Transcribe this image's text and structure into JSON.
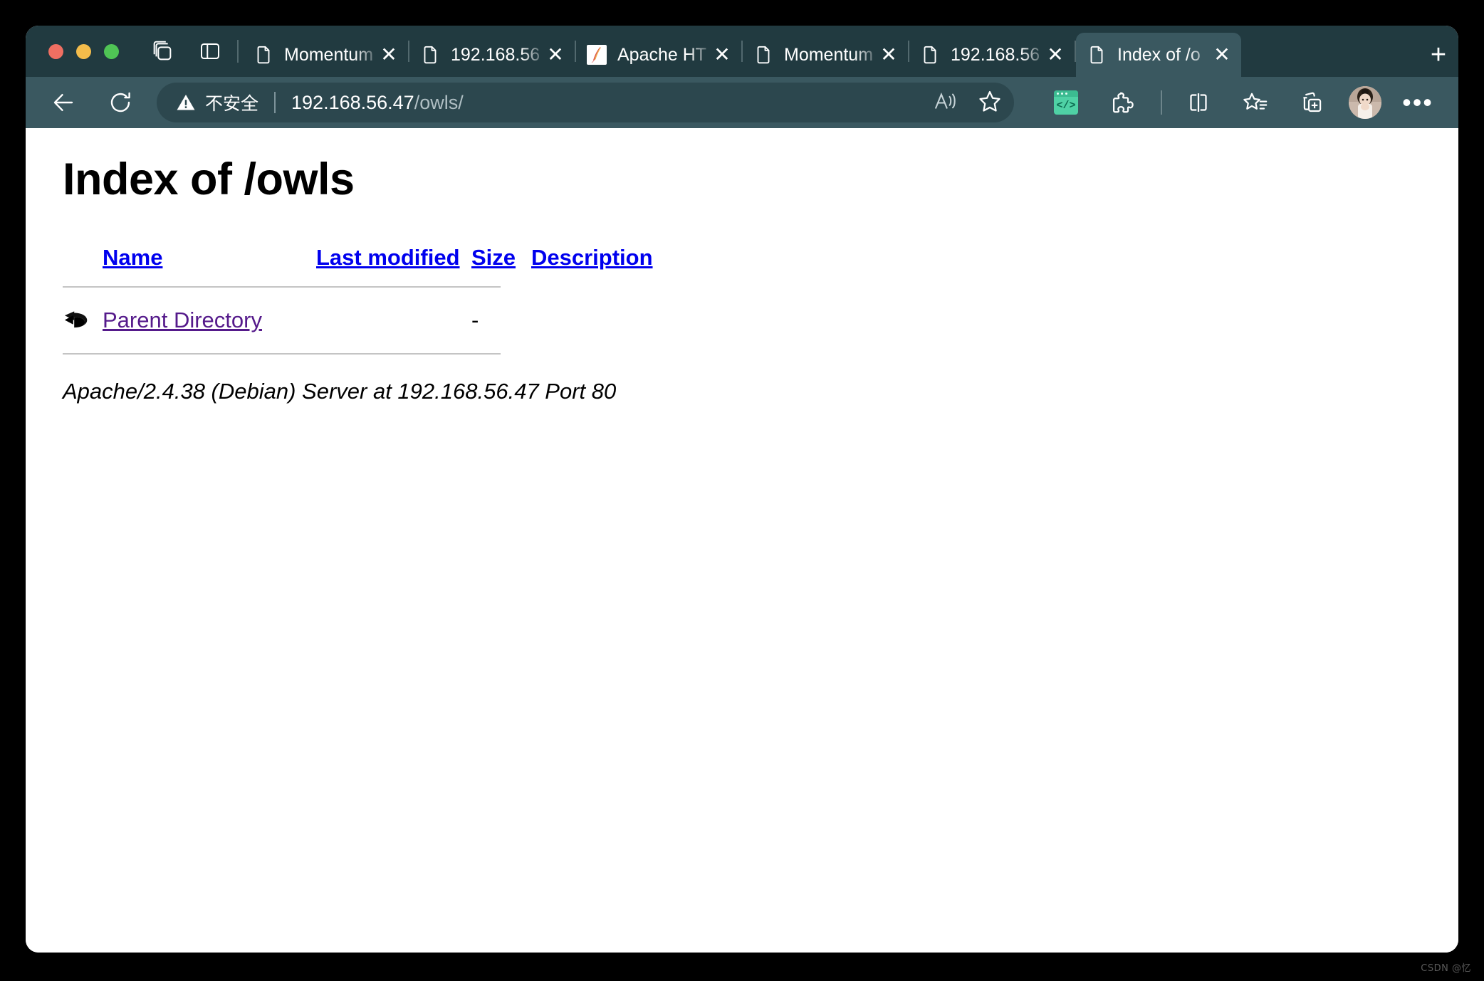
{
  "window": {
    "traffic_lights": [
      "close",
      "minimize",
      "maximize"
    ],
    "colors": {
      "tabstrip_bg": "#213a40",
      "toolbar_bg": "#3a5860",
      "active_tab_bg": "#3a5860",
      "url_field_bg": "#2c474e",
      "link_blue": "#0000ee",
      "link_visited": "#551a8b",
      "devtools_green": "#4fd1a5"
    }
  },
  "tabstrip": {
    "tab_actions_label": "tab-actions",
    "sidebar_toggle_label": "sidebar-toggle",
    "new_tab_label": "+",
    "close_glyph": "✕",
    "tabs": [
      {
        "title": "Momentum",
        "favicon": "page-icon",
        "active": false
      },
      {
        "title": "192.168.56",
        "favicon": "page-icon",
        "active": false
      },
      {
        "title": "Apache HT",
        "favicon": "apache-feather-icon",
        "active": false
      },
      {
        "title": "Momentum",
        "favicon": "page-icon",
        "active": false
      },
      {
        "title": "192.168.56",
        "favicon": "page-icon",
        "active": false
      },
      {
        "title": "Index of /o",
        "favicon": "page-icon",
        "active": true
      }
    ]
  },
  "toolbar": {
    "back_label": "back-arrow-icon",
    "reload_label": "reload-icon",
    "security": {
      "icon": "warning-triangle-icon",
      "label": "不安全"
    },
    "url": {
      "host": "192.168.56.47",
      "path": "/owls/",
      "full": "192.168.56.47/owls/"
    },
    "read_aloud_label": "read-aloud-icon",
    "favorite_label": "favorite-star-icon",
    "devtools_label": "devtools-extension-icon",
    "devtools_text": "</>",
    "extensions_label": "puzzle-piece-icon",
    "split_screen_label": "split-screen-icon",
    "favorites_list_label": "favorites-list-icon",
    "collections_label": "collections-add-icon",
    "profile_label": "profile-avatar",
    "settings_label": "•••"
  },
  "page": {
    "title": "Index of /owls",
    "table": {
      "headers": [
        "Name",
        "Last modified",
        "Size",
        "Description"
      ],
      "rows": [
        {
          "icon": "back-arrow-icon",
          "name": "Parent Directory",
          "last_modified": "",
          "size": "-",
          "description": "",
          "visited": true
        }
      ]
    },
    "footer": "Apache/2.4.38 (Debian) Server at 192.168.56.47 Port 80"
  },
  "watermark": "CSDN @忆"
}
